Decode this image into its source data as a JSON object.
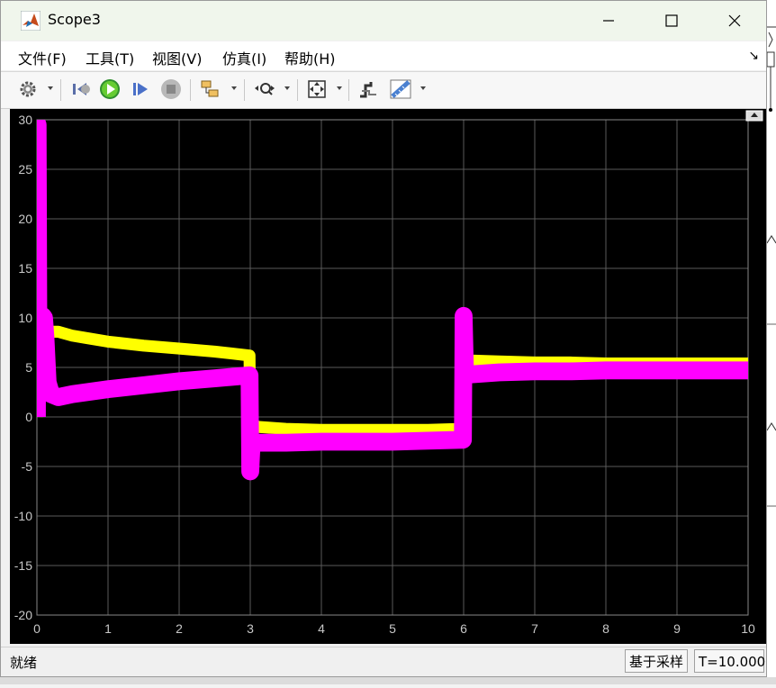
{
  "window": {
    "title": "Scope3",
    "colors": {
      "titlebar": "#f0f6ec",
      "plot_bg": "#000000",
      "grid": "#5a5a5a",
      "tick_label": "#c8c8c8"
    }
  },
  "menu": {
    "items": [
      {
        "label": "文件(F)",
        "id": "file"
      },
      {
        "label": "工具(T)",
        "id": "tools"
      },
      {
        "label": "视图(V)",
        "id": "view"
      },
      {
        "label": "仿真(I)",
        "id": "simulation"
      },
      {
        "label": "帮助(H)",
        "id": "help"
      }
    ]
  },
  "toolbar": {
    "icons": [
      "settings-icon",
      "step-back-icon",
      "run-icon",
      "step-forward-icon",
      "stop-icon",
      "highlight-icon",
      "zoom-icon",
      "fit-to-view-icon",
      "triggers-icon",
      "measurements-icon"
    ]
  },
  "status": {
    "left": "就绪",
    "mode": "基于采样",
    "time": "T=10.000"
  },
  "chart_data": {
    "type": "line",
    "title": "",
    "xlabel": "",
    "ylabel": "",
    "xlim": [
      0,
      10
    ],
    "ylim": [
      -20,
      30
    ],
    "xticks": [
      0,
      1,
      2,
      3,
      4,
      5,
      6,
      7,
      8,
      9,
      10
    ],
    "yticks": [
      -20,
      -15,
      -10,
      -5,
      0,
      5,
      10,
      15,
      20,
      25,
      30
    ],
    "grid": true,
    "series": [
      {
        "color": "#ffff00",
        "band": 0.6,
        "x": [
          0.0,
          0.02,
          0.05,
          0.08,
          0.12,
          0.15,
          0.2,
          0.3,
          0.5,
          1.0,
          1.5,
          2.0,
          2.5,
          2.99,
          3.0,
          3.02,
          3.1,
          3.5,
          4.0,
          4.5,
          5.0,
          5.5,
          5.99,
          6.0,
          6.02,
          6.1,
          6.5,
          7.0,
          7.5,
          8.0,
          8.5,
          9.0,
          9.5,
          10.0
        ],
        "y": [
          0,
          6.5,
          9.0,
          7.0,
          6.5,
          8.0,
          8.6,
          8.6,
          8.2,
          7.6,
          7.2,
          6.9,
          6.6,
          6.2,
          -5.0,
          -0.6,
          -1.0,
          -1.2,
          -1.3,
          -1.3,
          -1.3,
          -1.3,
          -1.2,
          9.0,
          5.8,
          5.7,
          5.6,
          5.5,
          5.5,
          5.4,
          5.4,
          5.4,
          5.4,
          5.4
        ]
      },
      {
        "color": "#ff00ff",
        "band": 0.9,
        "x": [
          0.0,
          0.01,
          0.02,
          0.03,
          0.05,
          0.08,
          0.1,
          0.12,
          0.15,
          0.2,
          0.3,
          0.5,
          1.0,
          1.5,
          2.0,
          2.5,
          2.99,
          3.0,
          3.02,
          3.1,
          3.5,
          4.0,
          4.5,
          5.0,
          5.5,
          5.99,
          6.0,
          6.02,
          6.1,
          6.5,
          7.0,
          7.5,
          8.0,
          8.5,
          9.0,
          9.5,
          10.0
        ],
        "y": [
          0,
          29.5,
          8.0,
          9.0,
          10.0,
          10.2,
          10.0,
          8.0,
          3.5,
          2.3,
          2.0,
          2.3,
          2.8,
          3.2,
          3.6,
          3.9,
          4.2,
          -5.5,
          -2.5,
          -2.6,
          -2.6,
          -2.5,
          -2.5,
          -2.5,
          -2.4,
          -2.3,
          10.2,
          4.2,
          4.3,
          4.5,
          4.6,
          4.6,
          4.7,
          4.7,
          4.7,
          4.7,
          4.7
        ]
      }
    ]
  }
}
